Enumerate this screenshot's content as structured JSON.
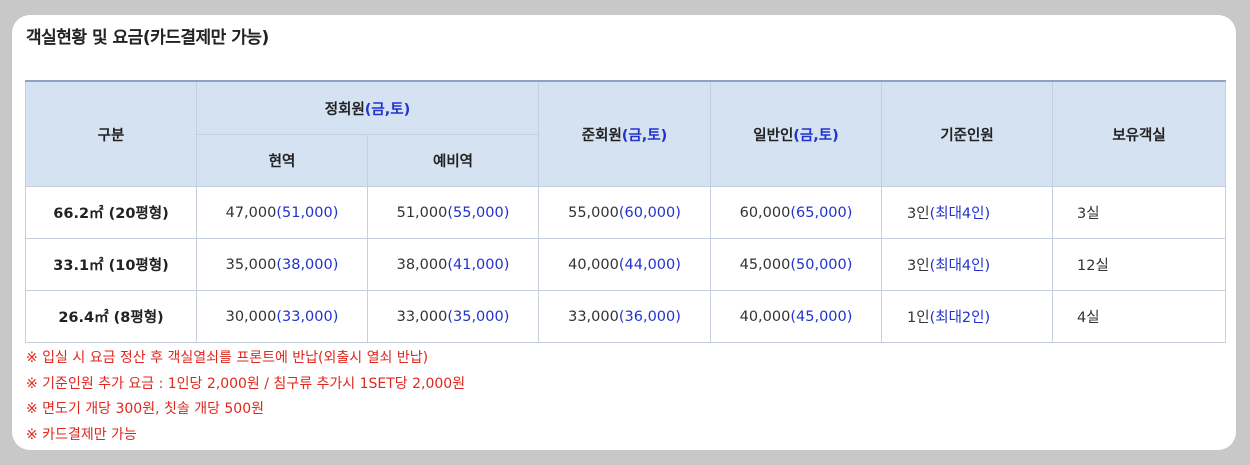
{
  "title": "객실현황 및 요금(카드결제만 가능)",
  "table": {
    "header": {
      "category": "구분",
      "regular_member": {
        "label": "정회원",
        "suffix": "(금,토)"
      },
      "regular_sub": [
        "현역",
        "예비역"
      ],
      "associate_member": {
        "label": "준회원",
        "suffix": "(금,토)"
      },
      "general": {
        "label": "일반인",
        "suffix": "(금,토)"
      },
      "standard_people": "기준인원",
      "rooms_owned": "보유객실"
    },
    "rows": [
      {
        "label": "66.2㎡ (20평형)",
        "active": {
          "base": "47,000",
          "weekend": "(51,000)"
        },
        "reserve": {
          "base": "51,000",
          "weekend": "(55,000)"
        },
        "associate": {
          "base": "55,000",
          "weekend": "(60,000)"
        },
        "general": {
          "base": "60,000",
          "weekend": "(65,000)"
        },
        "people": {
          "base": "3인",
          "max": "(최대4인)"
        },
        "rooms": "3실"
      },
      {
        "label": "33.1㎡ (10평형)",
        "active": {
          "base": "35,000",
          "weekend": "(38,000)"
        },
        "reserve": {
          "base": "38,000",
          "weekend": "(41,000)"
        },
        "associate": {
          "base": "40,000",
          "weekend": "(44,000)"
        },
        "general": {
          "base": "45,000",
          "weekend": "(50,000)"
        },
        "people": {
          "base": "3인",
          "max": "(최대4인)"
        },
        "rooms": "12실"
      },
      {
        "label": "26.4㎡ (8평형)",
        "active": {
          "base": "30,000",
          "weekend": "(33,000)"
        },
        "reserve": {
          "base": "33,000",
          "weekend": "(35,000)"
        },
        "associate": {
          "base": "33,000",
          "weekend": "(36,000)"
        },
        "general": {
          "base": "40,000",
          "weekend": "(45,000)"
        },
        "people": {
          "base": "1인",
          "max": "(최대2인)"
        },
        "rooms": "4실"
      }
    ]
  },
  "notes": [
    "※ 입실 시 요금 정산 후 객실열쇠를 프론트에 반납(외출시 열쇠 반납)",
    "※ 기준인원 추가 요금 : 1인당 2,000원 / 침구류 추가시 1SET당 2,000원",
    "※ 면도기 개당 300원, 칫솔 개당 500원",
    "※ 카드결제만 가능"
  ],
  "colors": {
    "header_bg": "#d5e2f2",
    "accent_blue": "#2233cc",
    "note_red": "#e0271e"
  }
}
